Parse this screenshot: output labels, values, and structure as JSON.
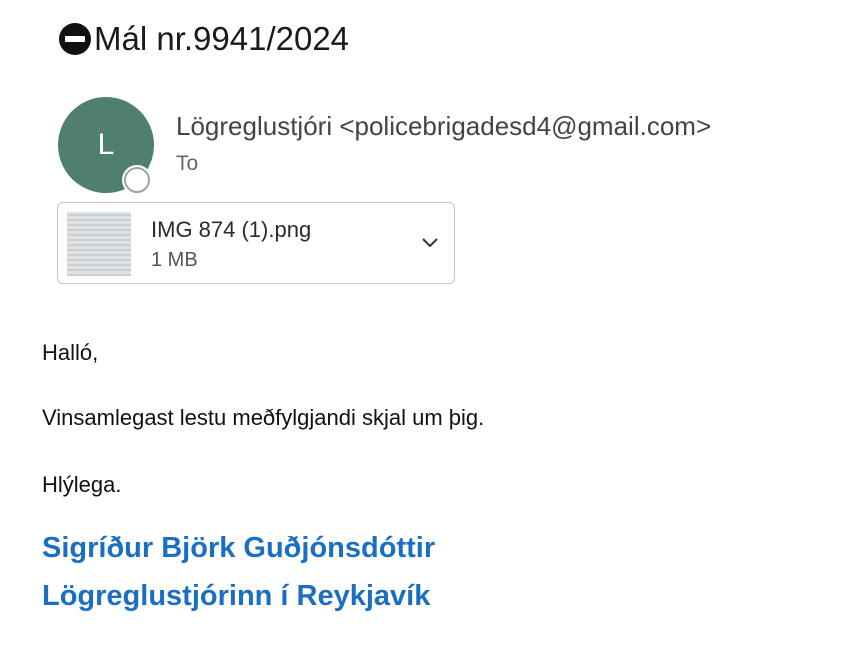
{
  "message": {
    "subject": "Mál nr.9941/2024",
    "subject_icon": "no-entry-icon",
    "sender": {
      "avatar_initial": "L",
      "avatar_color": "#4f7f70",
      "display": "Lögreglustjóri <policebrigadesd4@gmail.com>"
    },
    "to_label": "To",
    "attachment": {
      "filename": "IMG 874 (1).png",
      "size": "1 MB",
      "menu_icon": "chevron-down-icon"
    },
    "body": {
      "greeting": "Halló,",
      "line1": "Vinsamlegast lestu meðfylgjandi skjal um þig.",
      "closing": "Hlýlega."
    },
    "signature": {
      "name": "Sigríður Björk Guðjónsdóttir",
      "title": "Lögreglustjórinn í Reykjavík",
      "color": "#1a6fc2"
    }
  }
}
